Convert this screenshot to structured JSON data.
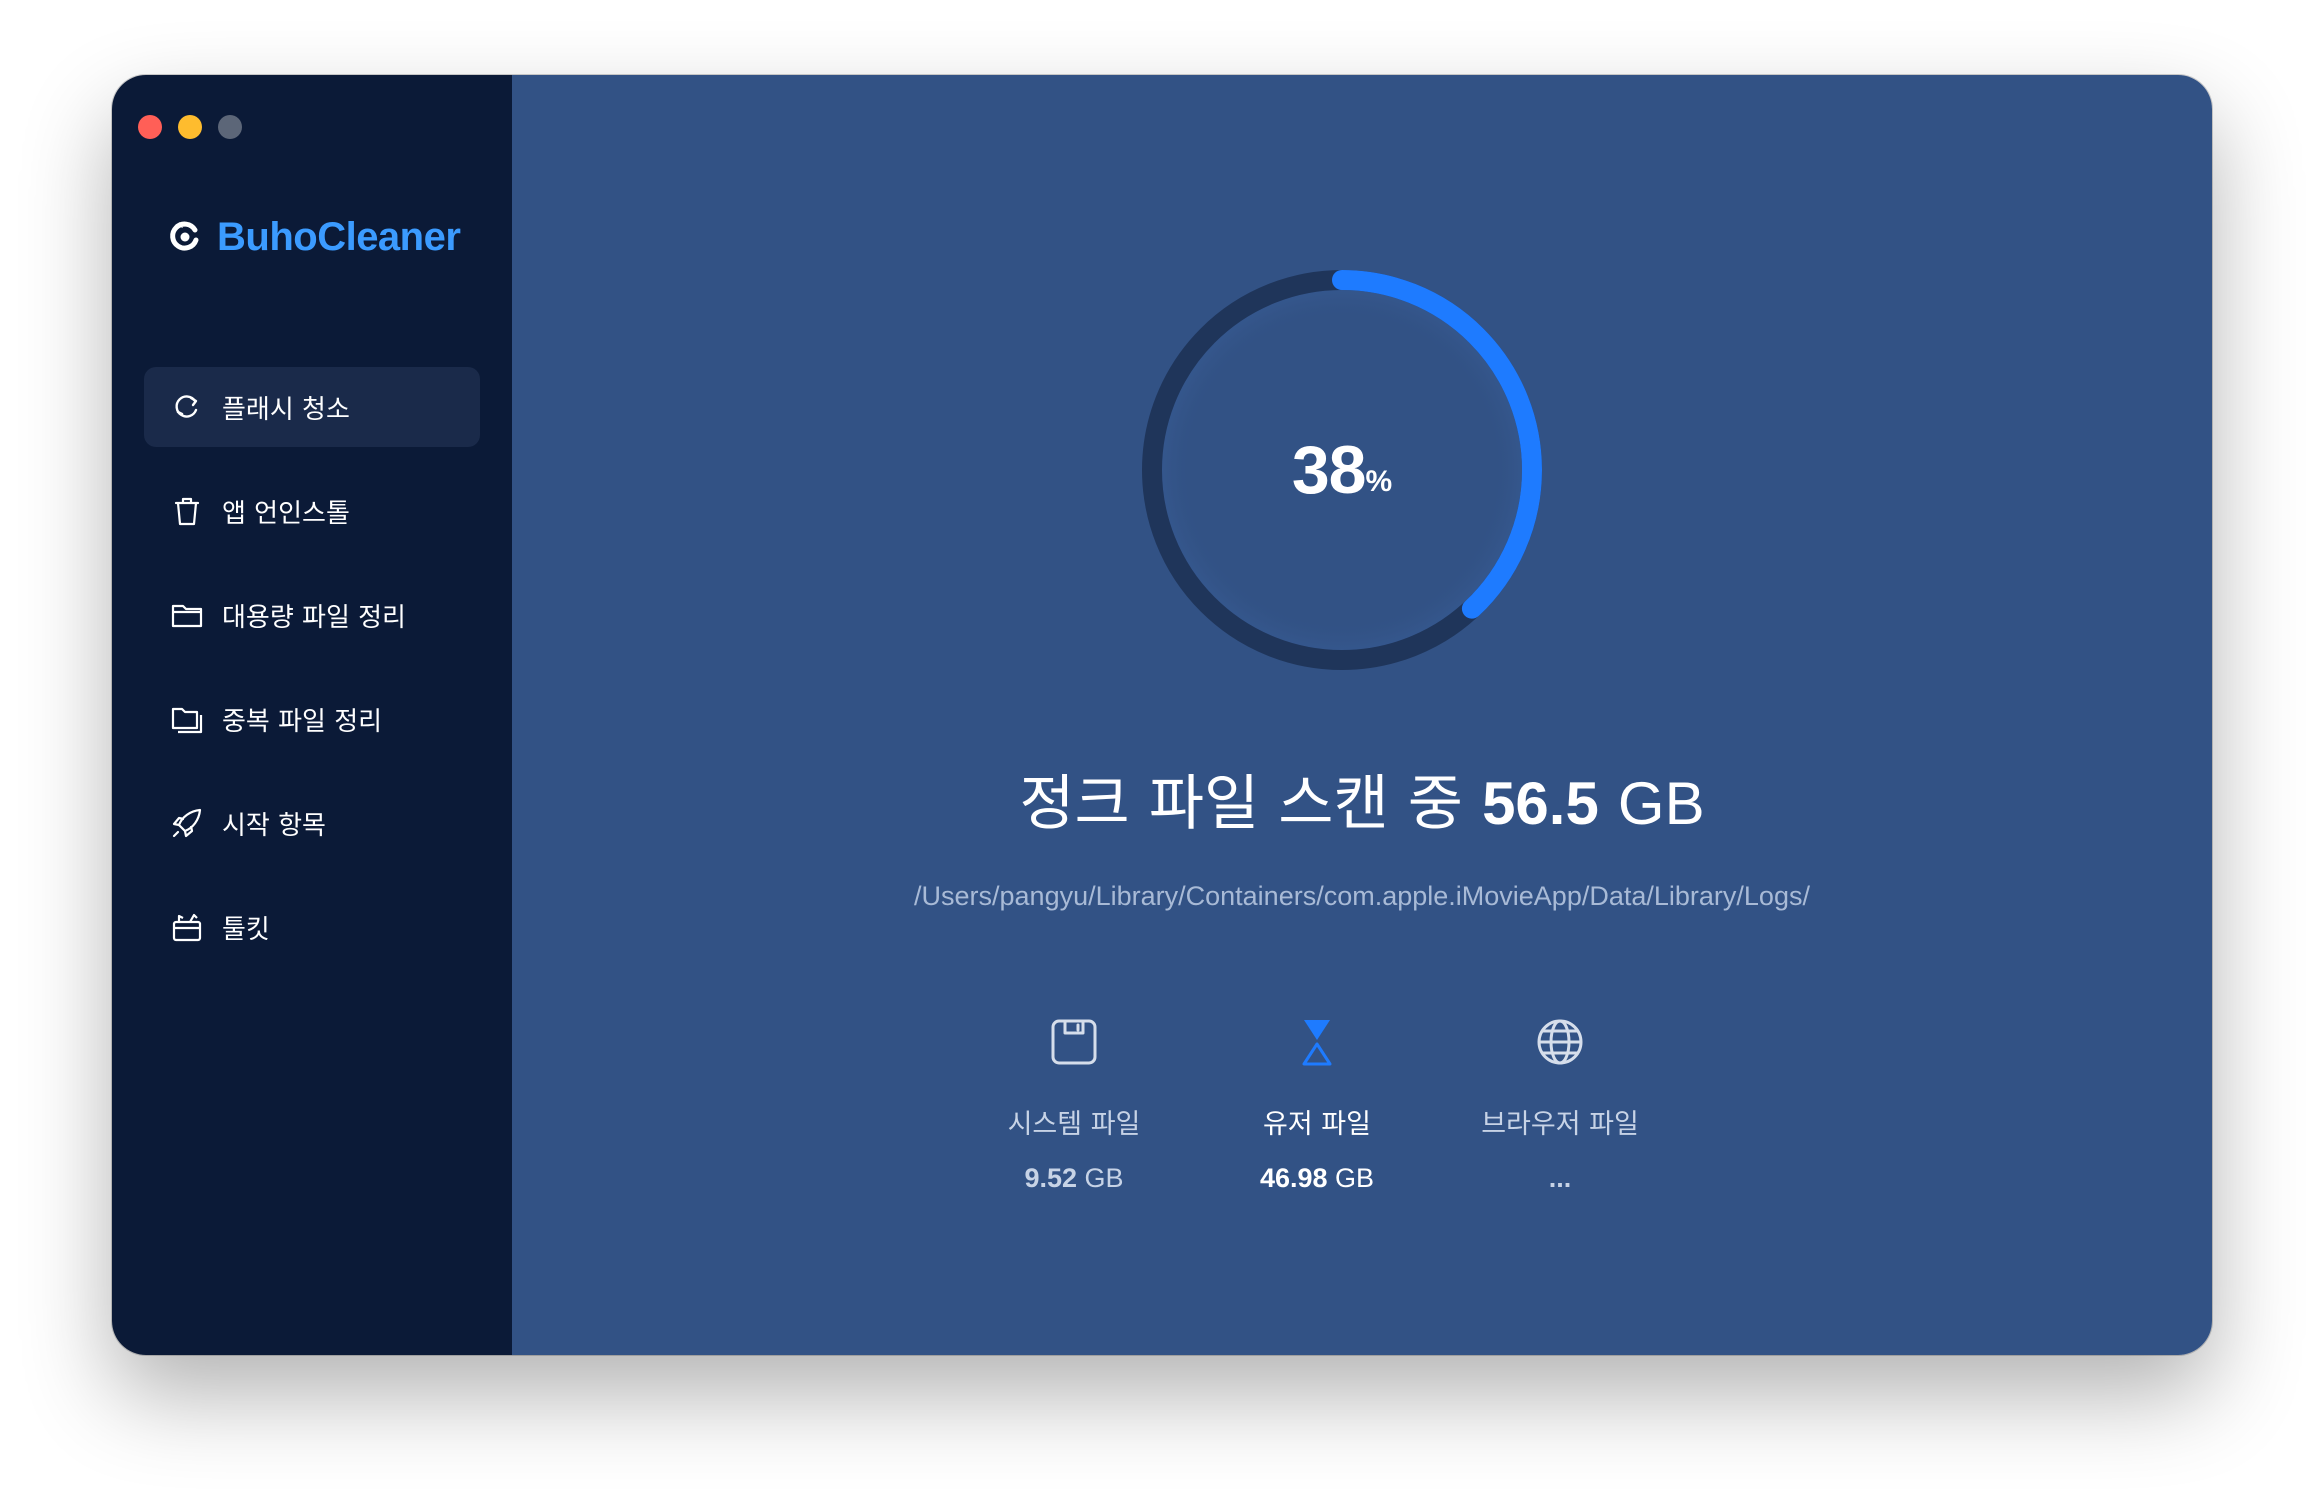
{
  "app": {
    "name": "BuhoCleaner"
  },
  "sidebar": {
    "items": [
      {
        "label": "플래시 청소",
        "icon": "refresh-icon",
        "active": true
      },
      {
        "label": "앱 언인스톨",
        "icon": "trash-icon",
        "active": false
      },
      {
        "label": "대용량 파일 정리",
        "icon": "folder-icon",
        "active": false
      },
      {
        "label": "중복 파일 정리",
        "icon": "duplicate-folder-icon",
        "active": false
      },
      {
        "label": "시작 항목",
        "icon": "rocket-icon",
        "active": false
      },
      {
        "label": "툴킷",
        "icon": "toolkit-icon",
        "active": false
      }
    ]
  },
  "scan": {
    "progress_percent": 38,
    "progress_num": "38",
    "progress_sym": "%",
    "headline_prefix": "정크 파일 스캔 중",
    "headline_amount": "56.5",
    "headline_unit": "GB",
    "current_path": "/Users/pangyu/Library/Containers/com.apple.iMovieApp/Data/Library/Logs/"
  },
  "categories": [
    {
      "label": "시스템 파일",
      "size_value": "9.52",
      "size_unit": "GB",
      "icon": "disk-icon",
      "state": "done"
    },
    {
      "label": "유저 파일",
      "size_value": "46.98",
      "size_unit": "GB",
      "icon": "hourglass-icon",
      "state": "scanning"
    },
    {
      "label": "브라우저 파일",
      "size_value": "...",
      "size_unit": "",
      "icon": "globe-icon",
      "state": "pending"
    }
  ],
  "colors": {
    "sidebar_bg": "#0b1a37",
    "main_bg": "#325285",
    "accent": "#1e7bff",
    "brand": "#3b9bff",
    "ring_track": "#1f355a"
  }
}
